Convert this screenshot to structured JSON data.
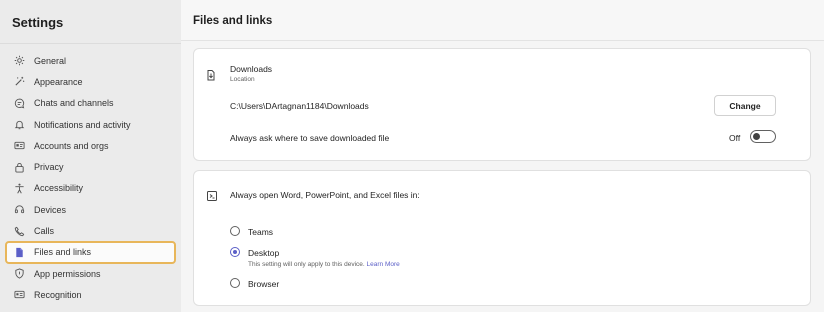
{
  "sidebar": {
    "title": "Settings",
    "items": [
      {
        "label": "General",
        "icon": "gear-icon"
      },
      {
        "label": "Appearance",
        "icon": "magic-wand-icon"
      },
      {
        "label": "Chats and channels",
        "icon": "chat-icon"
      },
      {
        "label": "Notifications and activity",
        "icon": "bell-icon"
      },
      {
        "label": "Accounts and orgs",
        "icon": "id-card-icon"
      },
      {
        "label": "Privacy",
        "icon": "lock-icon"
      },
      {
        "label": "Accessibility",
        "icon": "accessibility-icon"
      },
      {
        "label": "Devices",
        "icon": "headset-icon"
      },
      {
        "label": "Calls",
        "icon": "phone-icon"
      },
      {
        "label": "Files and links",
        "icon": "document-icon"
      },
      {
        "label": "App permissions",
        "icon": "shield-icon"
      },
      {
        "label": "Recognition",
        "icon": "recognition-icon"
      }
    ],
    "active_index": 9
  },
  "main": {
    "title": "Files and links",
    "downloads": {
      "title": "Downloads",
      "subtitle": "Location",
      "path": "C:\\Users\\DArtagnan1184\\Downloads",
      "change_label": "Change",
      "ask_label": "Always ask where to save downloaded file",
      "ask_state": "Off"
    },
    "open_files": {
      "title": "Always open Word, PowerPoint, and Excel files in:",
      "options": [
        {
          "label": "Teams",
          "checked": false
        },
        {
          "label": "Desktop",
          "checked": true,
          "note": "This setting will only apply to this device.",
          "link": "Learn More"
        },
        {
          "label": "Browser",
          "checked": false
        }
      ]
    }
  },
  "colors": {
    "accent": "#5b5fc7",
    "highlight_outline": "#e8b65a"
  }
}
